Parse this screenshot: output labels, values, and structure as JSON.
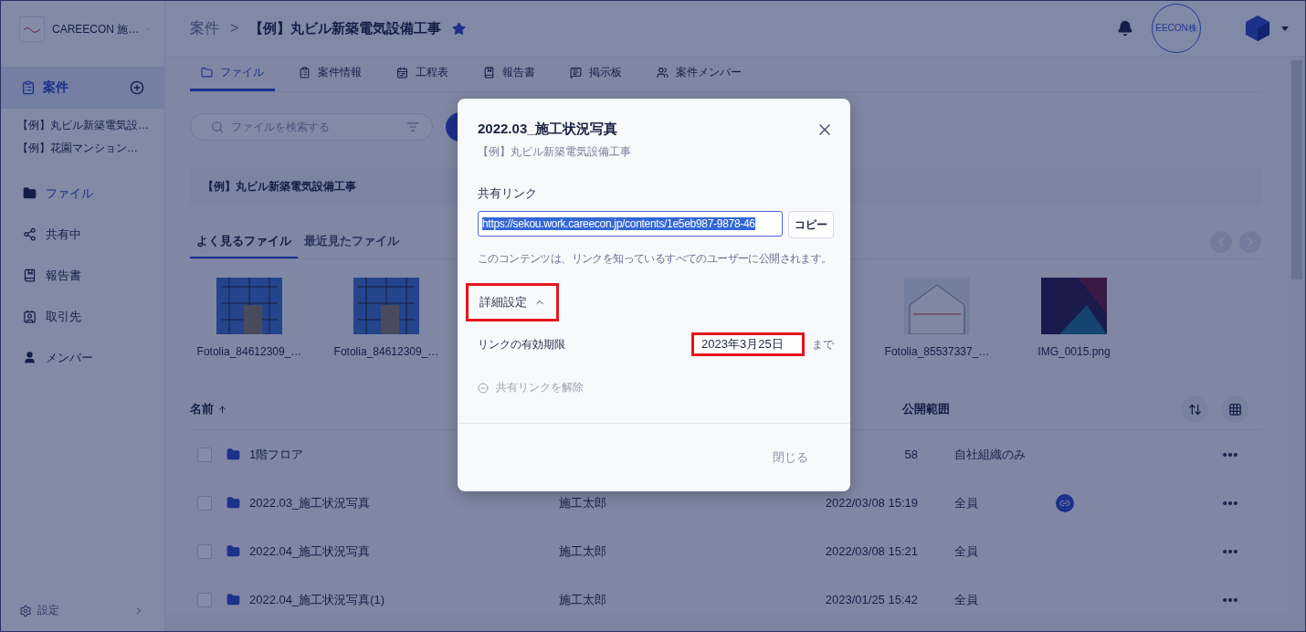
{
  "sidebar": {
    "org_name": "CAREECON 施…",
    "nav": [
      {
        "label": "案件",
        "selected": true,
        "kind": "section"
      }
    ],
    "projects": [
      {
        "label": "【例】丸ビル新築電気設…"
      },
      {
        "label": "【例】花園マンション…"
      }
    ],
    "items": [
      {
        "label": "ファイル",
        "selected": true
      },
      {
        "label": "共有中",
        "selected": false
      },
      {
        "label": "報告書",
        "selected": false
      },
      {
        "label": "取引先",
        "selected": false
      },
      {
        "label": "メンバー",
        "selected": false
      }
    ],
    "settings": "設定"
  },
  "header": {
    "breadcrumb": "案件",
    "separator": ">",
    "title": "【例】丸ビル新築電気設備工事",
    "starred": true,
    "avatar_text": "EECON株"
  },
  "tabs": [
    {
      "label": "ファイル",
      "selected": true
    },
    {
      "label": "案件情報",
      "selected": false
    },
    {
      "label": "工程表",
      "selected": false
    },
    {
      "label": "報告書",
      "selected": false
    },
    {
      "label": "掲示板",
      "selected": false
    },
    {
      "label": "案件メンバー",
      "selected": false
    }
  ],
  "search": {
    "placeholder": "ファイルを検索する"
  },
  "project_banner": "【例】丸ビル新築電気設備工事",
  "file_tabs": [
    {
      "label": "よく見るファイル",
      "selected": true
    },
    {
      "label": "最近見たファイル",
      "selected": false
    }
  ],
  "thumbnails": [
    {
      "name": "Fotolia_84612309_…",
      "kind": "scaffold"
    },
    {
      "name": "Fotolia_84612309_…",
      "kind": "scaffold"
    },
    {
      "name": "Fotolia_85537337_…",
      "kind": "house"
    },
    {
      "name": "IMG_0015.png",
      "kind": "screen"
    }
  ],
  "table": {
    "columns": [
      {
        "label": "名前",
        "sorted": true
      },
      {
        "label": "公開範囲",
        "sorted": false
      }
    ],
    "rows": [
      {
        "name": "1階フロア",
        "owner": "",
        "date": "58",
        "scope": "自社組織のみ",
        "checked": false,
        "shared": false
      },
      {
        "name": "2022.03_施工状況写真",
        "owner": "施工太郎",
        "date": "2022/03/08 15:19",
        "scope": "全員",
        "checked": false,
        "shared": true
      },
      {
        "name": "2022.04_施工状況写真",
        "owner": "施工太郎",
        "date": "2022/03/08 15:21",
        "scope": "全員",
        "checked": false,
        "shared": false
      },
      {
        "name": "2022.04_施工状況写真(1)",
        "owner": "施工太郎",
        "date": "2023/01/25 15:42",
        "scope": "全員",
        "checked": false,
        "shared": false
      }
    ]
  },
  "dialog": {
    "title": "2022.03_施工状況写真",
    "subtitle": "【例】丸ビル新築電気設備工事",
    "link_label": "共有リンク",
    "link_url": "https://sekou.work.careecon.jp/contents/1e5eb987-9878-46",
    "link_selected": true,
    "copy_button": "コピー",
    "notice": "このコンテンツは、リンクを知っているすべてのユーザーに公開されます。",
    "advanced": {
      "label": "詳細設定",
      "expanded": true,
      "annotated": true
    },
    "expiry": {
      "label": "リンクの有効期限",
      "value": "2023年3月25日",
      "suffix": "まで",
      "annotated": true
    },
    "unshare": {
      "label": "共有リンクを解除",
      "disabled": true
    },
    "close_button": "閉じる"
  }
}
